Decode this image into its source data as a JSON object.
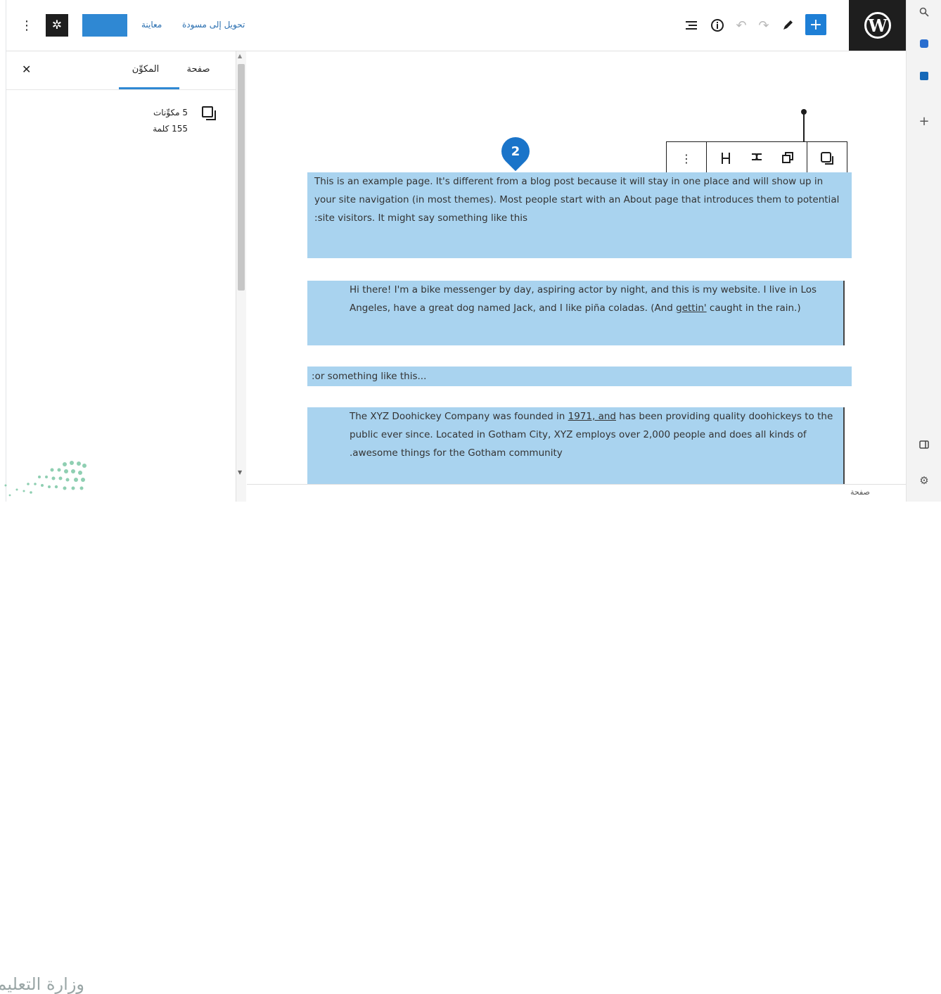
{
  "topbar": {
    "menu_icon": "vertical-dots-icon",
    "settings_icon": "gear-icon",
    "publish_label": "",
    "preview_label": "معاينة",
    "switch_to_draft_label": "تحويل إلى مسودة",
    "outline_icon": "list-view-icon",
    "info_icon": "info-icon",
    "undo_icon": "undo-icon",
    "redo_icon": "redo-icon",
    "tools_icon": "pencil-icon",
    "add_icon": "plus-icon",
    "logo_letter": "W"
  },
  "sidebar": {
    "close_icon": "close-icon",
    "tabs": [
      {
        "label": "صفحة"
      },
      {
        "label": "المكوِّن"
      }
    ],
    "stats": {
      "blocks": "5 مكوِّنات",
      "words": "155 كلمة"
    }
  },
  "block_toolbar": {
    "options_icon": "vertical-dots-icon",
    "tools": [
      "ungroup-icon",
      "transform-icon",
      "duplicate-icon"
    ],
    "parent_icon": "multi-block-icon"
  },
  "marker": {
    "label": "2"
  },
  "content": {
    "blocks": [
      {
        "text": "This is an example page. It's different from a blog post because it will stay in one place and will show up in your site navigation (in most themes). Most people start with an About page that introduces them to potential site visitors. It might say something like this:"
      },
      {
        "text_a": "Hi there! I'm a bike messenger by day, aspiring actor by night, and this is my website. I live in Los Angeles, have a great dog named Jack, and I like piña coladas. (And ",
        "link": "gettin'",
        "text_b": " caught in the rain.)"
      },
      {
        "text": "...or something like this:"
      },
      {
        "text_a": "The XYZ Doohickey Company was founded in ",
        "link": "1971, and",
        "text_b": " has been providing quality doohickeys to the public ever since. Located in Gotham City, XYZ employs over 2,000 people and does all kinds of awesome things for the Gotham community."
      }
    ]
  },
  "footer": {
    "label": "صفحة"
  },
  "browser_sidebar": {
    "icons": [
      "search-icon",
      "copilot-icon",
      "outlook-icon",
      "plus-icon",
      "split-panel-icon",
      "gear-icon"
    ]
  },
  "ministry": {
    "text": "وزارة التعليم"
  }
}
